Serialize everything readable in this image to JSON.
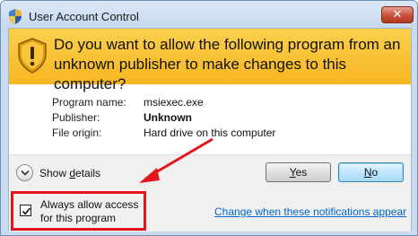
{
  "window": {
    "title": "User Account Control",
    "close_label": "✕"
  },
  "banner": {
    "question": "Do you want to allow the following program from an unknown publisher to make changes to this computer?"
  },
  "details": [
    {
      "label": "Program name:",
      "value": "msiexec.exe",
      "bold": false
    },
    {
      "label": "Publisher:",
      "value": "Unknown",
      "bold": true
    },
    {
      "label": "File origin:",
      "value": "Hard drive on this computer",
      "bold": false
    }
  ],
  "footer": {
    "show_details_prefix": "Show ",
    "show_details_underlined": "d",
    "show_details_suffix": "etails",
    "yes_underlined": "Y",
    "yes_rest": "es",
    "no_underlined": "N",
    "no_rest": "o",
    "always_allow_label": "Always allow access for this program",
    "always_allow_checked": true,
    "notifications_link": "Change when these notifications appear"
  },
  "colors": {
    "banner": "#f6b621",
    "annotation": "#e8141c",
    "link": "#0066cc"
  },
  "icons": {
    "title_icon": "uac-shield-icon",
    "banner_icon": "warning-shield-icon",
    "expand_icon": "chevron-down-icon",
    "annotation_icon": "red-arrow-icon"
  }
}
